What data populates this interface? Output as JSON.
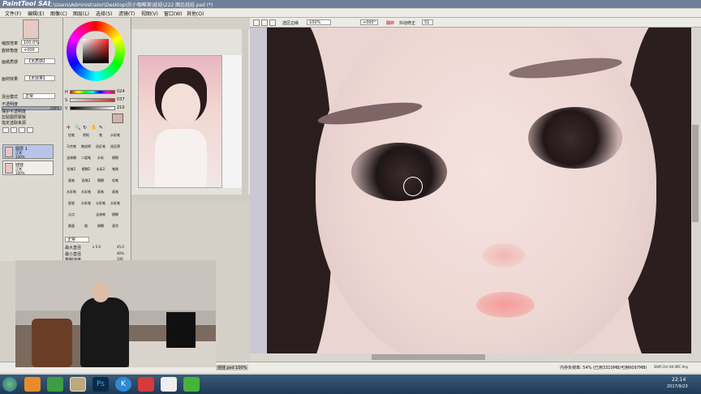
{
  "window": {
    "logo": "PaintTool SAI",
    "title": "C:\\Users\\Administrator\\Desktop\\仿小咖唯美\\娃娃\\222 图比娃娃.psd (*)"
  },
  "menu": [
    "文件(F)",
    "编辑(E)",
    "图像(C)",
    "图层(L)",
    "选择(S)",
    "滤镜(T)",
    "视图(V)",
    "窗口(W)",
    "其他(O)"
  ],
  "left_panel": {
    "zoom_label": "缩放倍率",
    "zoom_value": "100.0%",
    "angle_label": "旋转角度",
    "angle_value": "+000",
    "texture_label": "画纸质感",
    "texture_value": "【无质感】",
    "effect_label": "画材效果",
    "effect_value": "【无效果】",
    "blend_label": "混合模式",
    "blend_value": "正常",
    "opacity_label": "不透明度",
    "opacity_value": "100%",
    "checks": [
      "保护不透明度",
      "剪贴图层蒙版",
      "指定选取来源"
    ],
    "layers": [
      {
        "name": "图层 1",
        "mode": "正常",
        "opacity": "100%",
        "selected": true
      },
      {
        "name": "娃娃",
        "mode": "正常",
        "opacity": "100%",
        "selected": false
      }
    ]
  },
  "color": {
    "h_label": "H",
    "h_value": "024",
    "s_label": "S",
    "s_value": "037",
    "v_label": "V",
    "v_value": "210",
    "current": "#d2b3a8",
    "wheel_colors": [
      "#ff0000",
      "#ffff00",
      "#00ff00",
      "#00ffff",
      "#0000ff",
      "#ff00ff"
    ]
  },
  "tools": {
    "grid": [
      "铅笔",
      "喷枪",
      "笔",
      "水彩笔",
      "马克笔",
      "橡皮擦",
      "选区笔",
      "选区擦",
      "油漆桶",
      "二值笔",
      "水彩",
      "模糊",
      "铅笔2",
      "模糊2",
      "水彩2",
      "笔刷",
      "画笔",
      "画笔2",
      "模糊",
      "铅笔",
      "水彩笔",
      "水彩笔",
      "画笔",
      "画笔",
      "星星",
      "水彩笔",
      "水彩笔",
      "水彩笔",
      "点点",
      "",
      "油漆笔",
      "模糊",
      "跳蛋",
      "粗",
      "模糊",
      "速涂"
    ],
    "mode_label": "正常",
    "max_size_label": "最大直径",
    "max_size_mult": "x 5.0",
    "max_size_value": "45.0",
    "min_size_label": "最小直径",
    "min_size_value": "46%",
    "density_label": "笔刷浓度",
    "density_value": "100"
  },
  "canvas_toolbar": {
    "antialias_label": "选区边缘",
    "zoom": "100%",
    "rotation": "+000°",
    "flip_label": "翻转",
    "stabilizer_label": "抖动修正",
    "stabilizer_value": "S1"
  },
  "status": {
    "file_tab": "娃娃.psd",
    "file_zoom": "100%",
    "memory": "内存负荷率: 54% (已用3310MB/可用6097MB)",
    "keys": "Shift Ctrl Alt SPC Any"
  },
  "taskbar": {
    "time": "22:14",
    "date": "2017/9/23"
  }
}
